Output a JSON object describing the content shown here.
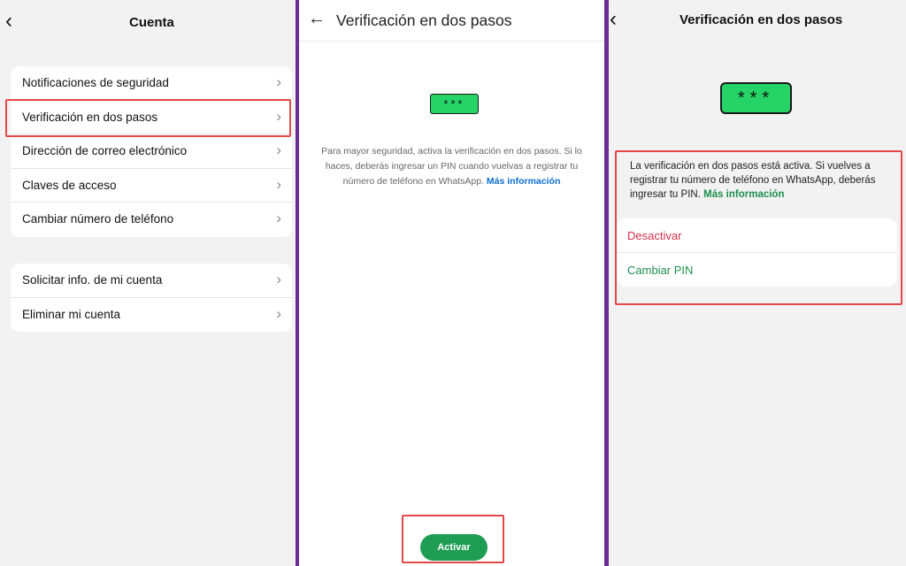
{
  "panel1": {
    "title": "Cuenta",
    "back_glyph": "‹",
    "group1": [
      {
        "label": "Notificaciones de seguridad"
      },
      {
        "label": "Verificación en dos pasos"
      },
      {
        "label": "Dirección de correo electrónico"
      },
      {
        "label": "Claves de acceso"
      },
      {
        "label": "Cambiar número de teléfono"
      }
    ],
    "group2": [
      {
        "label": "Solicitar info. de mi cuenta"
      },
      {
        "label": "Eliminar mi cuenta"
      }
    ],
    "chevron": "›"
  },
  "panel2": {
    "back_glyph": "←",
    "title": "Verificación en dos pasos",
    "pin_placeholder": "***",
    "description": "Para mayor seguridad, activa la verificación en dos pasos. Si lo haces, deberás ingresar un PIN cuando vuelvas a registrar tu número de teléfono en WhatsApp.",
    "link": "Más información",
    "button": "Activar"
  },
  "panel3": {
    "back_glyph": "‹",
    "title": "Verificación en dos pasos",
    "pin_placeholder": "***",
    "description": "La verificación en dos pasos está activa. Si vuelves a registrar tu número de teléfono en WhatsApp, deberás ingresar tu PIN.",
    "link": "Más información",
    "actions": {
      "disable": "Desactivar",
      "change_pin": "Cambiar PIN"
    }
  },
  "colors": {
    "accent_green": "#25d366",
    "button_green": "#1f9d55",
    "link_blue": "#0a6ed1",
    "danger_red": "#d6304a",
    "highlight_red": "#e44848",
    "divider_purple": "#6a2d91"
  },
  "icons": {
    "back": "chevron-left-icon",
    "arrow_back": "arrow-left-icon",
    "row_chevron": "chevron-right-icon"
  }
}
